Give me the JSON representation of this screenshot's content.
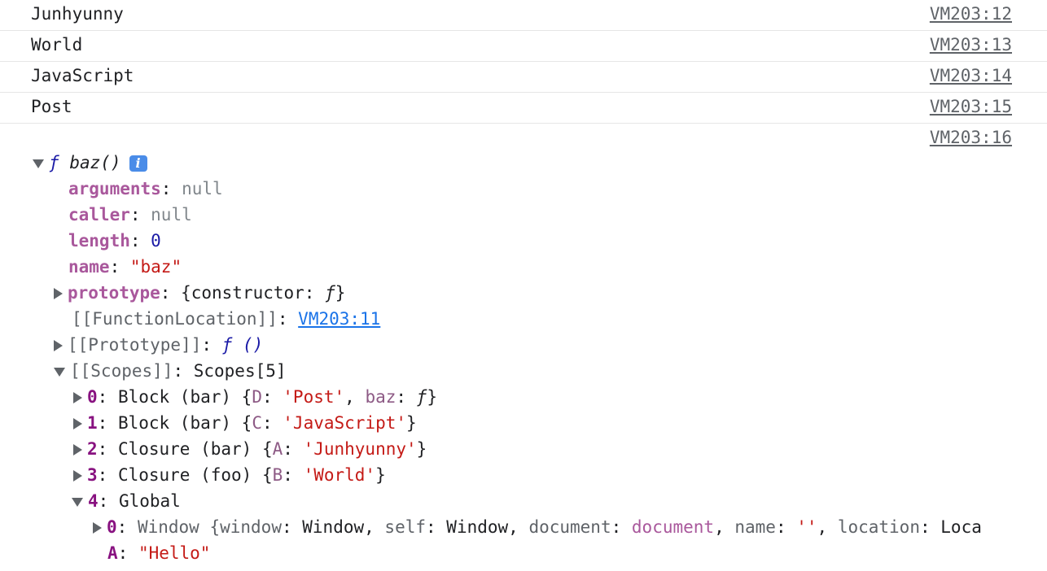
{
  "logs": [
    {
      "text": "Junhyunny",
      "source": "VM203:12"
    },
    {
      "text": "World",
      "source": "VM203:13"
    },
    {
      "text": "JavaScript",
      "source": "VM203:14"
    },
    {
      "text": "Post",
      "source": "VM203:15"
    }
  ],
  "obj": {
    "source": "VM203:16",
    "f_symbol": "ƒ",
    "title": "baz()",
    "info_icon": "i",
    "props": {
      "arguments": {
        "key": "arguments",
        "value": "null"
      },
      "caller": {
        "key": "caller",
        "value": "null"
      },
      "length": {
        "key": "length",
        "value": "0"
      },
      "name": {
        "key": "name",
        "value": "\"baz\""
      },
      "prototype": {
        "key": "prototype",
        "value_open": "{constructor: ",
        "value_f": "ƒ",
        "value_close": "}"
      },
      "function_location": {
        "key": "[[FunctionLocation]]",
        "link": "VM203:11"
      },
      "proto": {
        "key": "[[Prototype]]",
        "value": "ƒ ()"
      },
      "scopes": {
        "key": "[[Scopes]]",
        "value": "Scopes[5]"
      }
    },
    "scopes": [
      {
        "index": "0",
        "label": "Block (bar) {",
        "k1": "D",
        "v1": "'Post'",
        "k2": "baz",
        "v2": "ƒ",
        "close": "}"
      },
      {
        "index": "1",
        "label": "Block (bar) {",
        "k1": "C",
        "v1": "'JavaScript'",
        "close": "}"
      },
      {
        "index": "2",
        "label": "Closure (bar) {",
        "k1": "A",
        "v1": "'Junhyunny'",
        "close": "}"
      },
      {
        "index": "3",
        "label": "Closure (foo) {",
        "k1": "B",
        "v1": "'World'",
        "close": "}"
      },
      {
        "index": "4",
        "label": "Global"
      }
    ],
    "global": {
      "item0": {
        "index": "0",
        "label": "Window {",
        "pairs": [
          {
            "k": "window",
            "v": "Window"
          },
          {
            "k": "self",
            "v": "Window"
          },
          {
            "k": "document",
            "v": "document"
          },
          {
            "k": "name",
            "v": "''"
          },
          {
            "k": "location",
            "v": "Loca"
          }
        ]
      },
      "A": {
        "key": "A",
        "value": "\"Hello\""
      }
    }
  }
}
